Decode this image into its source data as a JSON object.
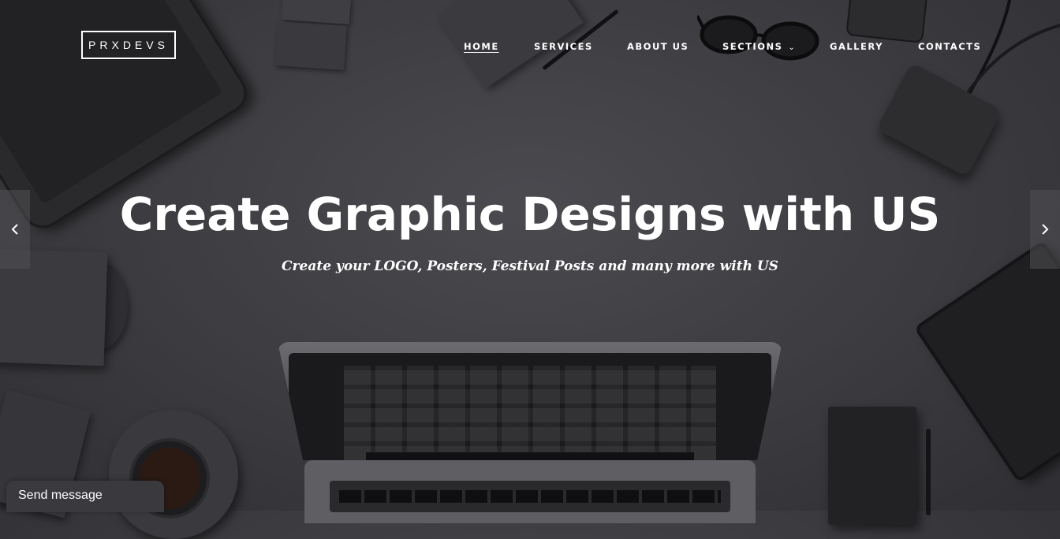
{
  "brand": {
    "logo_text": "PRXDEVS"
  },
  "nav": {
    "items": [
      {
        "label": "HOME",
        "active": true
      },
      {
        "label": "SERVICES",
        "active": false
      },
      {
        "label": "ABOUT US",
        "active": false
      },
      {
        "label": "SECTIONS",
        "active": false,
        "has_dropdown": true
      },
      {
        "label": "GALLERY",
        "active": false
      },
      {
        "label": "CONTACTS",
        "active": false
      }
    ],
    "dropdown_icon": "chevron-down-icon"
  },
  "hero": {
    "title": "Create Graphic Designs with US",
    "subtitle": "Create your LOGO, Posters, Festival Posts and many more with US"
  },
  "slider": {
    "prev_icon": "chevron-left-icon",
    "next_icon": "chevron-right-icon"
  },
  "chat_widget": {
    "label": "Send message"
  },
  "colors": {
    "background": "#3c3c40",
    "text": "#ffffff",
    "arrow_bg": "#505054",
    "widget_bg": "#3a3a3e"
  }
}
